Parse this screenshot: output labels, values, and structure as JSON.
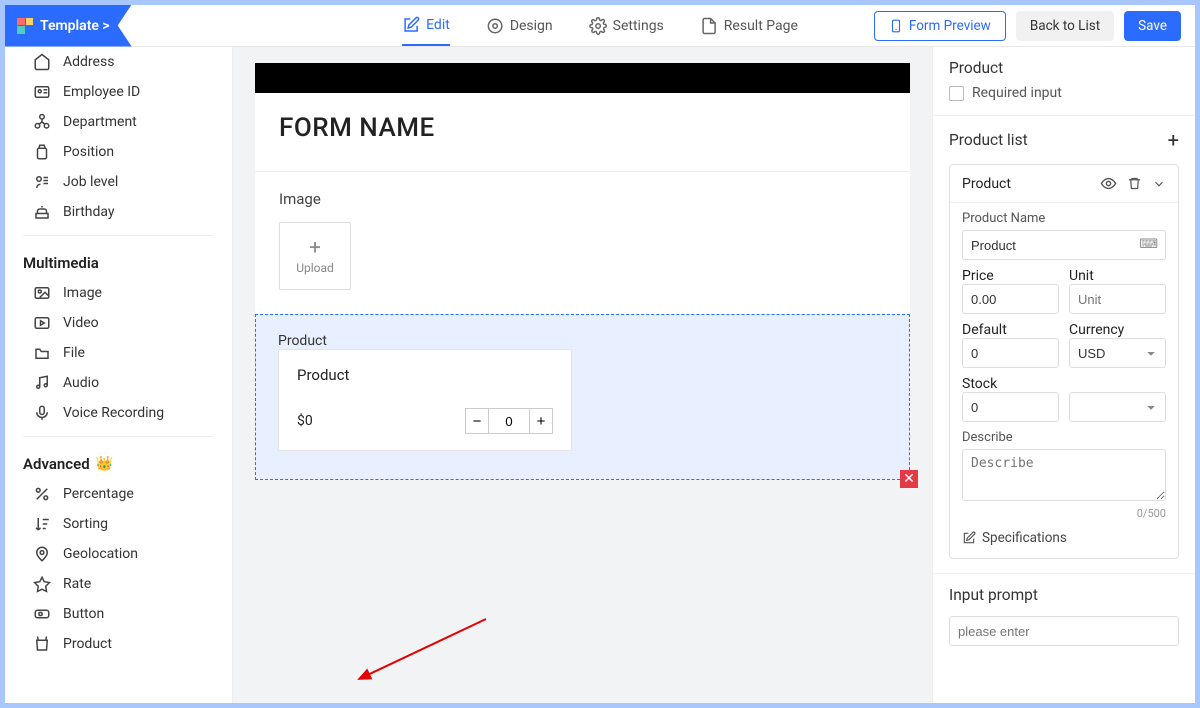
{
  "brand": {
    "title": "Template >"
  },
  "topnav": {
    "edit": "Edit",
    "design": "Design",
    "settings": "Settings",
    "result": "Result Page"
  },
  "actions": {
    "preview": "Form Preview",
    "back": "Back to List",
    "save": "Save"
  },
  "sidebar": {
    "items_top": [
      {
        "label": "Address"
      },
      {
        "label": "Employee ID"
      },
      {
        "label": "Department"
      },
      {
        "label": "Position"
      },
      {
        "label": "Job level"
      },
      {
        "label": "Birthday"
      }
    ],
    "group_multimedia": "Multimedia",
    "items_mm": [
      {
        "label": "Image"
      },
      {
        "label": "Video"
      },
      {
        "label": "File"
      },
      {
        "label": "Audio"
      },
      {
        "label": "Voice Recording"
      }
    ],
    "group_advanced": "Advanced",
    "items_adv": [
      {
        "label": "Percentage"
      },
      {
        "label": "Sorting"
      },
      {
        "label": "Geolocation"
      },
      {
        "label": "Rate"
      },
      {
        "label": "Button"
      },
      {
        "label": "Product"
      }
    ]
  },
  "canvas": {
    "form_title": "FORM NAME",
    "image_label": "Image",
    "upload_text": "Upload",
    "product_label": "Product",
    "product_card": {
      "name": "Product",
      "price": "$0",
      "qty": "0"
    }
  },
  "rpanel": {
    "section_title": "Product",
    "required_label": "Required input",
    "product_list_title": "Product list",
    "item_name": "Product",
    "fields": {
      "name_label": "Product Name",
      "name_value": "Product",
      "price_label": "Price",
      "price_value": "0.00",
      "unit_label": "Unit",
      "unit_placeholder": "Unit",
      "default_label": "Default",
      "default_value": "0",
      "currency_label": "Currency",
      "currency_value": "USD",
      "stock_label": "Stock",
      "stock_value": "0",
      "describe_label": "Describe",
      "describe_placeholder": "Describe",
      "char_count": "0/500",
      "specifications": "Specifications"
    },
    "input_prompt_title": "Input prompt",
    "input_prompt_placeholder": "please enter"
  }
}
